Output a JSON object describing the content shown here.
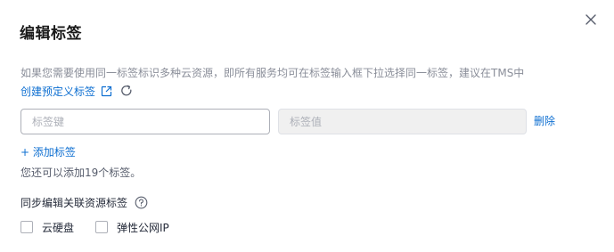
{
  "dialog": {
    "title": "编辑标签",
    "close_icon": "close-icon"
  },
  "hint": {
    "text": "如果您需要使用同一标签标识多种云资源，即所有服务均可在标签输入框下拉选择同一标签，建议在TMS中",
    "link_text": "创建预定义标签",
    "link_icon": "external-link-icon",
    "refresh_icon": "refresh-icon"
  },
  "tag_row": {
    "key_placeholder": "标签键",
    "value_placeholder": "标签值",
    "delete_label": "删除"
  },
  "add_tag_label": "+ 添加标签",
  "remaining_text": "您还可以添加19个标签。",
  "sync": {
    "label": "同步编辑关联资源标签",
    "help_icon": "help-icon",
    "options": [
      {
        "label": "云硬盘",
        "checked": false
      },
      {
        "label": "弹性公网IP",
        "checked": false
      }
    ]
  },
  "colors": {
    "link": "#0e6fd1",
    "muted_text": "#8a8e99",
    "border": "#adb0b8",
    "disabled_bg": "#f0f0f0"
  }
}
